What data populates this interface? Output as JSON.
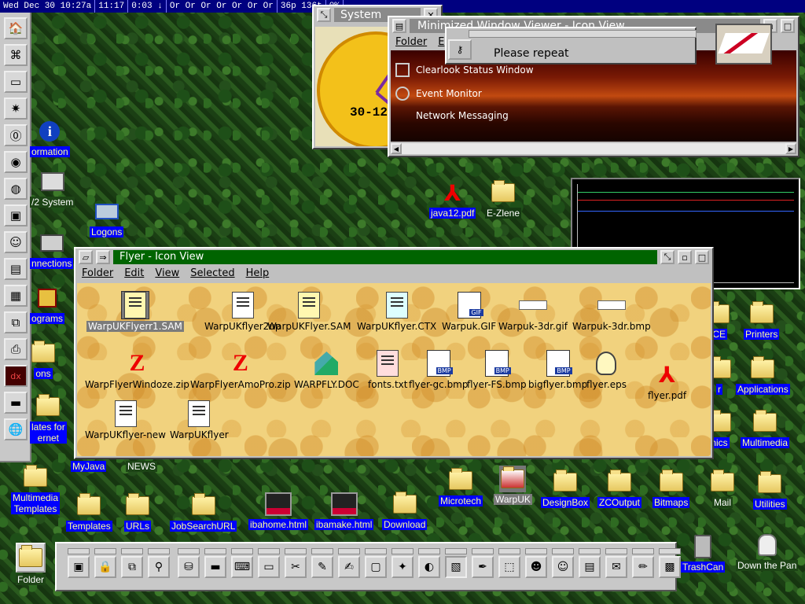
{
  "topbar": [
    "Wed Dec 30 10:27a",
    "11:17",
    "0:03 ↓",
    "Or Or Or Or Or Or Or",
    "36p 136t",
    "0%"
  ],
  "desktop_icons": {
    "information": "ormation",
    "os2_system": "/2 System",
    "logons": "Logons",
    "connections": "nnections",
    "programs": "ograms",
    "icons": "ons",
    "templates_internet": "lates for\nernet",
    "java12": "java12.pdf",
    "ezlene": "E-Zlene",
    "myjava": "MyJava",
    "news": "NEWS",
    "multimedia_templates": "Multimedia\nTemplates",
    "templates": "Templates",
    "urls": "URLs",
    "jobsearch": "JobSearchURL",
    "ibahome": "ibahome.html",
    "ibamake": "ibamake.html",
    "download": "Download",
    "microtech": "Microtech",
    "warpuk": "WarpUK",
    "designbox": "DesignBox",
    "zcoutput": "ZCOutput",
    "bitmaps": "Bitmaps",
    "mail": "Mail",
    "utilities": "Utilities",
    "trashcan": "TrashCan",
    "down_the_pan": "Down the Pan",
    "folder": "Folder",
    "ice": "ICE",
    "printers": "Printers",
    "applications": "Applications",
    "multimedia": "Multimedia",
    "graphics": "hics",
    "r": "r"
  },
  "flyer": {
    "title": "Flyer - Icon View",
    "menu": [
      "Folder",
      "Edit",
      "View",
      "Selected",
      "Help"
    ],
    "icons": [
      "WarpUKFlyerr1.SAM",
      "WarpUKflyer2up",
      "WarpUKFlyer.SAM",
      "WarpUKflyer.CTX",
      "Warpuk.GIF",
      "Warpuk-3dr.gif",
      "Warpuk-3dr.bmp",
      "WarpFlyerWindoze.zip",
      "WarpFlyerAmoPro.zip",
      "WARPFLY.DOC",
      "fonts.txt",
      "flyer-gc.bmp",
      "flyer-FS.bmp",
      "bigflyer.bmp",
      "flyer.eps",
      "flyer.pdf",
      "WarpUKflyer-new",
      "WarpUKflyer"
    ]
  },
  "mwv": {
    "title": "Minimized Window Viewer - Icon View",
    "menu": [
      "Folder",
      "E"
    ],
    "items": [
      "Clearlook Status Window",
      "Event Monitor",
      "Network Messaging"
    ]
  },
  "system_window": {
    "title": "System",
    "clock_date": "30-12-"
  },
  "dialog": {
    "message": "Please repeat"
  },
  "colors": {
    "flyer_title": "#006400",
    "label_bg": "#0000ff",
    "desktop": "#1d4416"
  }
}
